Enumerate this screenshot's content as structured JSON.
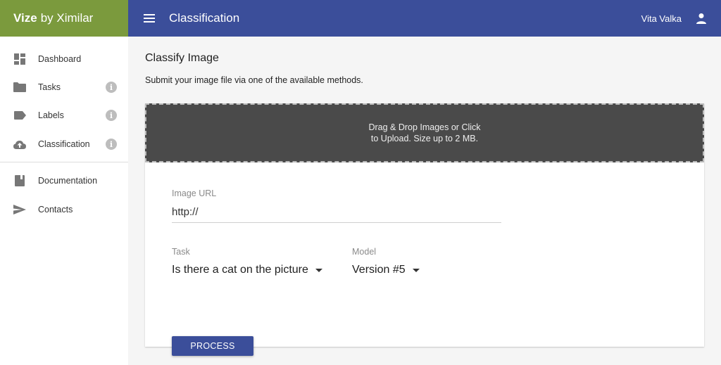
{
  "brand": {
    "name_bold": "Vize",
    "name_rest": "by Ximilar"
  },
  "header": {
    "title": "Classification",
    "user": "Vita Valka"
  },
  "sidebar": {
    "items": [
      {
        "label": "Dashboard",
        "icon": "dashboard-icon",
        "info": false
      },
      {
        "label": "Tasks",
        "icon": "folder-icon",
        "info": true
      },
      {
        "label": "Labels",
        "icon": "label-icon",
        "info": true
      },
      {
        "label": "Classification",
        "icon": "cloud-upload-icon",
        "info": true
      },
      {
        "label": "Documentation",
        "icon": "book-icon",
        "info": false
      },
      {
        "label": "Contacts",
        "icon": "send-icon",
        "info": false
      }
    ],
    "info_glyph": "i"
  },
  "main": {
    "title": "Classify Image",
    "subtitle": "Submit your image file via one of the available methods.",
    "dropzone": {
      "line1": "Drag & Drop Images or Click",
      "line2": "to Upload. Size up to 2 MB."
    },
    "url": {
      "label": "Image URL",
      "value": "http://"
    },
    "task": {
      "label": "Task",
      "selected": "Is there a cat on the picture"
    },
    "model": {
      "label": "Model",
      "selected": "Version #5"
    },
    "process_label": "PROCESS"
  },
  "colors": {
    "brand_green": "#7b9a3d",
    "header_blue": "#3b4e9a",
    "dropzone_bg": "#4a4a4a"
  }
}
